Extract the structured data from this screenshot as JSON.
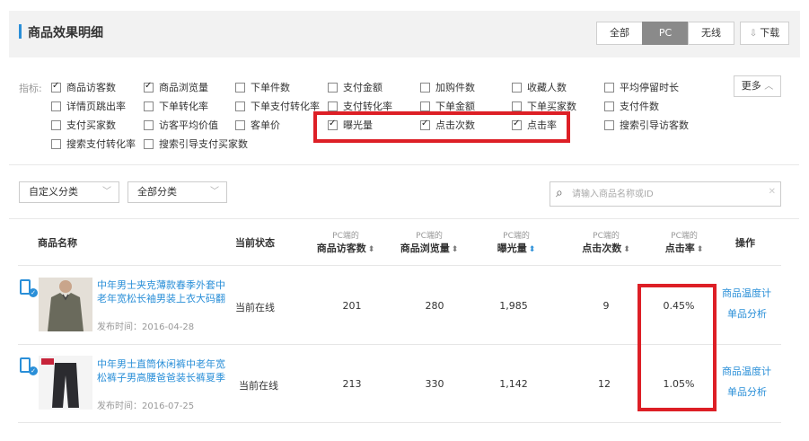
{
  "header": {
    "title": "商品效果明细",
    "segments": [
      {
        "label": "全部",
        "active": false
      },
      {
        "label": "PC",
        "active": true
      },
      {
        "label": "无线",
        "active": false
      }
    ],
    "download_label": "下载"
  },
  "indicators": {
    "label": "指标:",
    "more_label": "更多",
    "items": [
      {
        "label": "商品访客数",
        "checked": true
      },
      {
        "label": "商品浏览量",
        "checked": true
      },
      {
        "label": "下单件数",
        "checked": false
      },
      {
        "label": "支付金额",
        "checked": false
      },
      {
        "label": "加购件数",
        "checked": false
      },
      {
        "label": "收藏人数",
        "checked": false
      },
      {
        "label": "平均停留时长",
        "checked": false
      },
      {
        "label": "详情页跳出率",
        "checked": false
      },
      {
        "label": "下单转化率",
        "checked": false
      },
      {
        "label": "下单支付转化率",
        "checked": false
      },
      {
        "label": "支付转化率",
        "checked": false
      },
      {
        "label": "下单金额",
        "checked": false
      },
      {
        "label": "下单买家数",
        "checked": false
      },
      {
        "label": "支付件数",
        "checked": false
      },
      {
        "label": "支付买家数",
        "checked": false
      },
      {
        "label": "访客平均价值",
        "checked": false
      },
      {
        "label": "客单价",
        "checked": false
      },
      {
        "label": "曝光量",
        "checked": true
      },
      {
        "label": "点击次数",
        "checked": true
      },
      {
        "label": "点击率",
        "checked": true
      },
      {
        "label": "搜索引导访客数",
        "checked": false
      },
      {
        "label": "搜索支付转化率",
        "checked": false
      },
      {
        "label": "搜索引导支付买家数",
        "checked": false
      }
    ]
  },
  "filters": {
    "custom_category": "自定义分类",
    "all_category": "全部分类",
    "search_placeholder": "请输入商品名称或ID"
  },
  "table": {
    "columns": {
      "name": "商品名称",
      "status": "当前状态",
      "prefix": "PC端的",
      "visitors": "商品访客数",
      "views": "商品浏览量",
      "exposure": "曝光量",
      "clicks": "点击次数",
      "ctr": "点击率",
      "actions": "操作"
    },
    "rows": [
      {
        "name": "中年男士夹克薄款春季外套中老年宽松长袖男装上衣大码翻领爸",
        "date": "发布时间：2016-04-28",
        "status": "当前在线",
        "visitors": "201",
        "views": "280",
        "exposure": "1,985",
        "clicks": "9",
        "ctr": "0.45%",
        "action1": "商品温度计",
        "action2": "单品分析"
      },
      {
        "name": "中年男士直筒休闲裤中老年宽松裤子男高腰爸爸装长裤夏季男裤",
        "date": "发布时间：2016-07-25",
        "status": "当前在线",
        "visitors": "213",
        "views": "330",
        "exposure": "1,142",
        "clicks": "12",
        "ctr": "1.05%",
        "action1": "商品温度计",
        "action2": "单品分析"
      }
    ]
  },
  "colors": {
    "accent": "#2a8fd8",
    "highlight": "#dd1f26"
  }
}
